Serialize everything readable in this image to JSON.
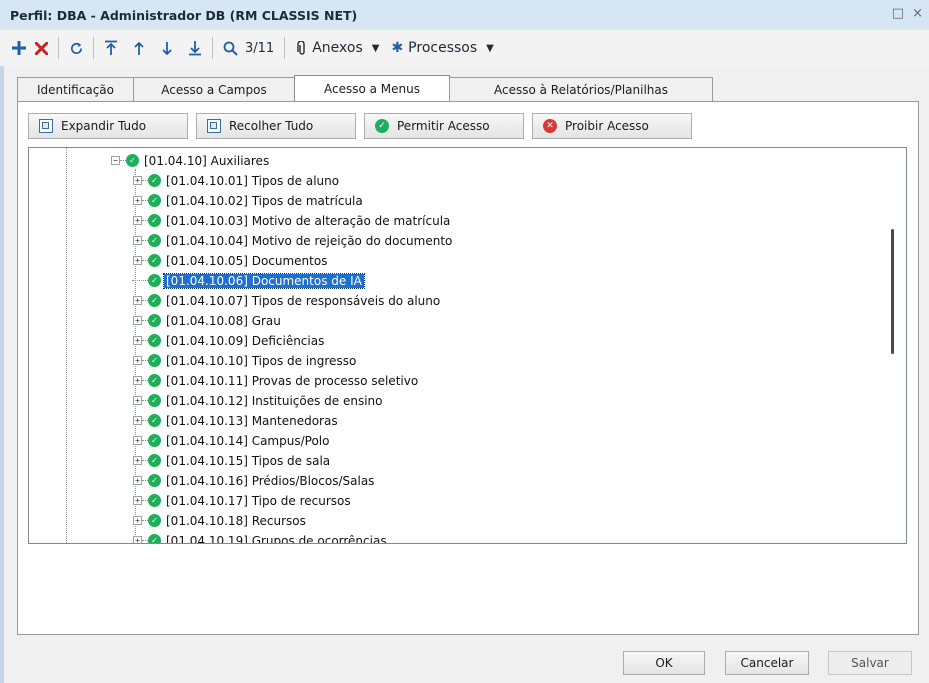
{
  "window": {
    "title": "Perfil: DBA - Administrador DB (RM CLASSIS NET)",
    "restore_glyph": "□",
    "close_glyph": "×"
  },
  "toolbar": {
    "counter": "3/11",
    "anexos_label": "Anexos",
    "processos_label": "Processos",
    "icons": [
      "plus-icon",
      "delete-icon",
      "refresh-icon",
      "first-icon",
      "prev-icon",
      "next-icon",
      "last-icon",
      "search-icon",
      "paperclip-icon",
      "gear-icon"
    ]
  },
  "tabs": [
    {
      "label": "Identificação",
      "active": false
    },
    {
      "label": "Acesso a Campos",
      "active": false
    },
    {
      "label": "Acesso a Menus",
      "active": true
    },
    {
      "label": "Acesso à Relatórios/Planilhas",
      "active": false
    }
  ],
  "actions": {
    "expand": "Expandir Tudo",
    "collapse": "Recolher Tudo",
    "allow": "Permitir Acesso",
    "deny": "Proibir Acesso"
  },
  "tree": {
    "parent": "[01.04.10] Auxiliares",
    "items": [
      {
        "label": "[01.04.10.01] Tipos de aluno",
        "expandable": true
      },
      {
        "label": "[01.04.10.02] Tipos de matrícula",
        "expandable": true
      },
      {
        "label": "[01.04.10.03] Motivo de alteração de matrícula",
        "expandable": true
      },
      {
        "label": "[01.04.10.04] Motivo de rejeição do documento",
        "expandable": true
      },
      {
        "label": "[01.04.10.05] Documentos",
        "expandable": true
      },
      {
        "label": "[01.04.10.06] Documentos de IA",
        "expandable": false,
        "selected": true
      },
      {
        "label": "[01.04.10.07] Tipos de responsáveis do aluno",
        "expandable": true
      },
      {
        "label": "[01.04.10.08] Grau",
        "expandable": true
      },
      {
        "label": "[01.04.10.09] Deficiências",
        "expandable": true
      },
      {
        "label": "[01.04.10.10] Tipos de ingresso",
        "expandable": true
      },
      {
        "label": "[01.04.10.11] Provas de processo seletivo",
        "expandable": true
      },
      {
        "label": "[01.04.10.12] Instituições de ensino",
        "expandable": true
      },
      {
        "label": "[01.04.10.13] Mantenedoras",
        "expandable": true
      },
      {
        "label": "[01.04.10.14] Campus/Polo",
        "expandable": true
      },
      {
        "label": "[01.04.10.15] Tipos de sala",
        "expandable": true
      },
      {
        "label": "[01.04.10.16] Prédios/Blocos/Salas",
        "expandable": true
      },
      {
        "label": "[01.04.10.17] Tipo de recursos",
        "expandable": true
      },
      {
        "label": "[01.04.10.18] Recursos",
        "expandable": true
      },
      {
        "label": "[01.04.10.19] Grupos de ocorrências",
        "expandable": true
      }
    ]
  },
  "footer": {
    "ok": "OK",
    "cancel": "Cancelar",
    "save": "Salvar"
  },
  "colors": {
    "titlebar": "#d6e6f5",
    "selection": "#1e6fcf",
    "ok_green": "#1fae5a",
    "deny_red": "#d93838",
    "plus_blue": "#1f5fa8",
    "delete_red": "#d21f1f"
  }
}
